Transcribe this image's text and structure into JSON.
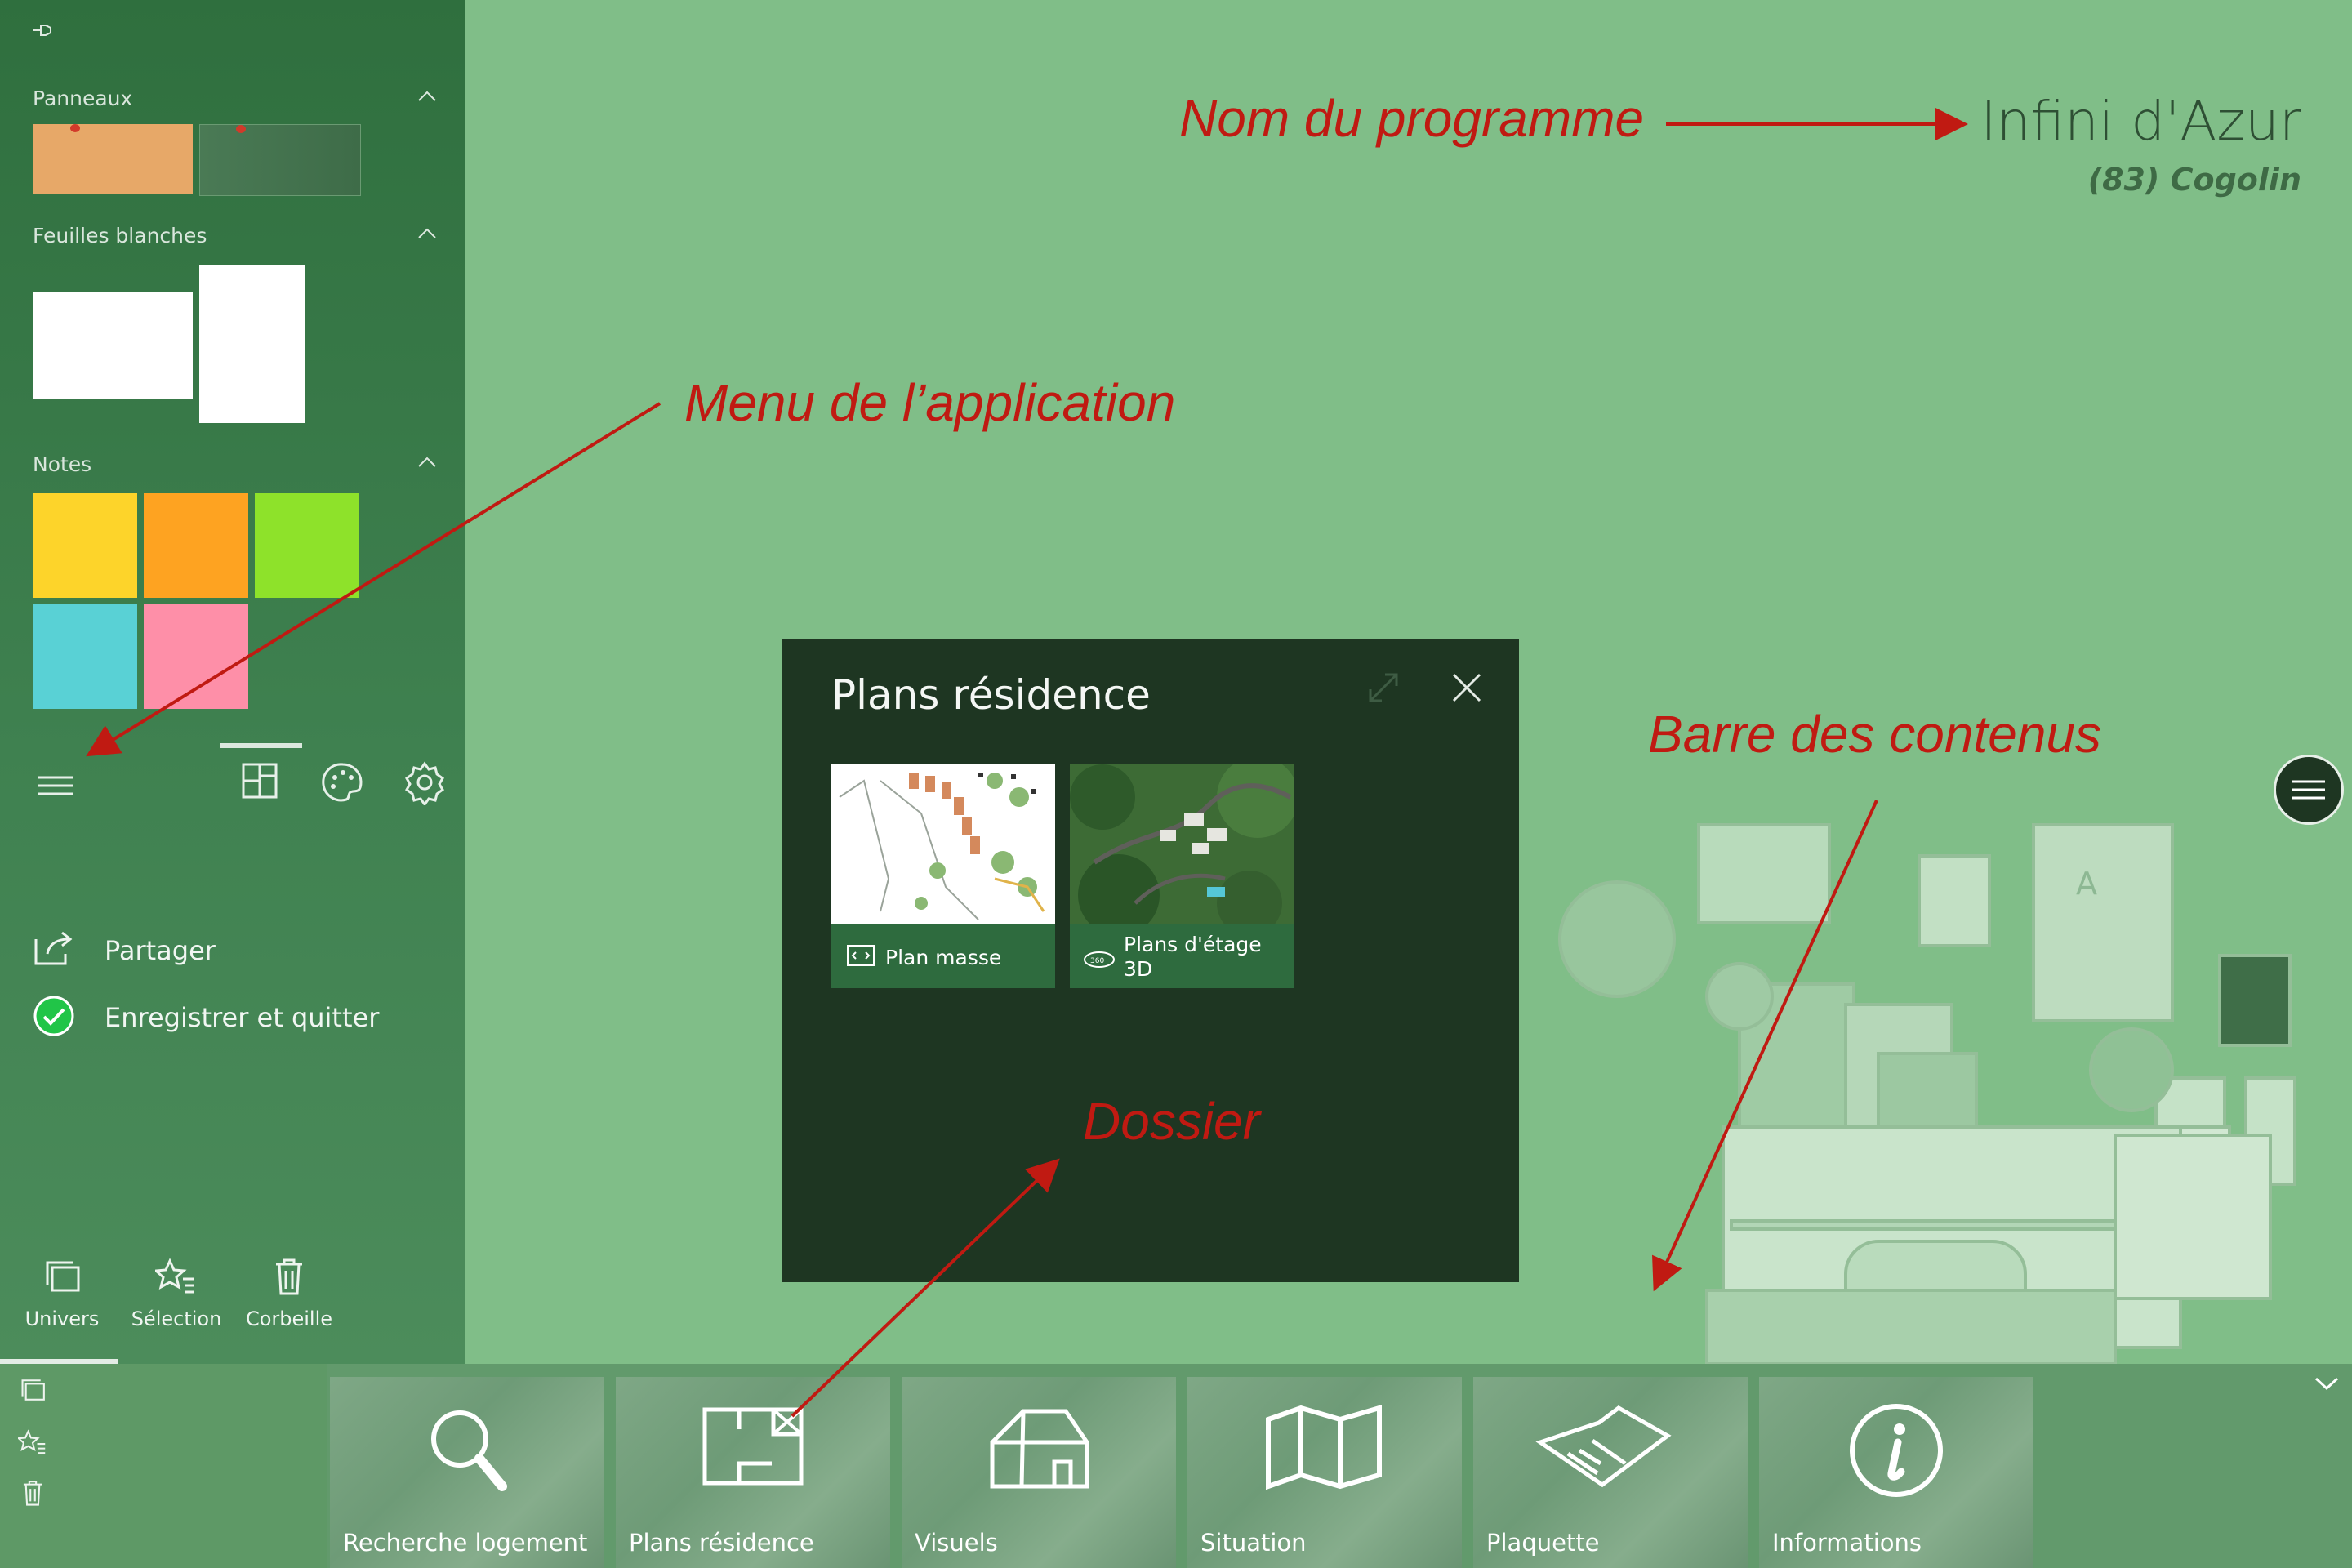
{
  "program": {
    "name": "Infini d'Azur",
    "location": "(83) Cogolin"
  },
  "sidebar": {
    "sections": {
      "panneaux": "Panneaux",
      "feuilles": "Feuilles blanches",
      "notes": "Notes"
    },
    "note_colors": [
      "#fdd42a",
      "#fea321",
      "#8ee22a",
      "#59d1d5",
      "#fe8fa8"
    ],
    "panel_colors": [
      "#e7a868",
      "#4a7a55"
    ],
    "menu": [
      {
        "label": "Partager",
        "icon": "share-icon"
      },
      {
        "label": "Enregistrer et quitter",
        "icon": "check-circle-icon"
      }
    ],
    "bottom": [
      {
        "label": "Univers",
        "icon": "layers-icon"
      },
      {
        "label": "Sélection",
        "icon": "star-list-icon"
      },
      {
        "label": "Corbeille",
        "icon": "trash-icon"
      }
    ]
  },
  "dialog": {
    "title": "Plans résidence",
    "items": [
      {
        "label": "Plan masse",
        "icon": "plan-icon"
      },
      {
        "label": "Plans d'étage 3D",
        "label_line1": "Plans d'étage",
        "label_line2": "3D",
        "icon": "view-360-icon"
      }
    ]
  },
  "content_bar": {
    "items": [
      {
        "label": "Recherche logement",
        "icon": "magnifier-icon"
      },
      {
        "label": "Plans résidence",
        "icon": "floorplan-icon"
      },
      {
        "label": "Visuels",
        "icon": "house-icon"
      },
      {
        "label": "Situation",
        "icon": "map-icon"
      },
      {
        "label": "Plaquette",
        "icon": "brochure-icon"
      },
      {
        "label": "Informations",
        "icon": "info-icon"
      }
    ]
  },
  "annotations": {
    "program": "Nom du programme",
    "menu": "Menu de l’application",
    "content_bar": "Barre des contenus",
    "folder": "Dossier"
  },
  "colors": {
    "annotation": "#c01a12",
    "background": "#80be88",
    "dialog": "#1e3622"
  }
}
